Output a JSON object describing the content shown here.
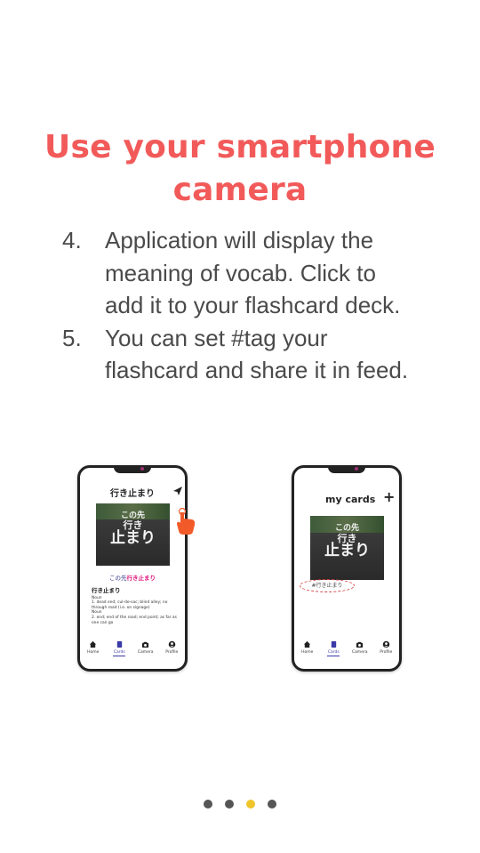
{
  "title": {
    "line1": "Use your smartphone",
    "line2": "camera"
  },
  "steps": [
    {
      "num": "4.",
      "lines": [
        "Application will display the",
        "meaning of vocab. Click to",
        "add it to your flashcard deck."
      ]
    },
    {
      "num": "5.",
      "lines": [
        "You can set #tag your",
        "flashcard and share it in feed."
      ]
    }
  ],
  "phone1": {
    "title": "行き止まり",
    "sign": [
      "この先",
      "行き",
      "止まり"
    ],
    "subtitle_prefix": "この先",
    "subtitle_highlight": "行き止まり",
    "definition": {
      "word": "行き止まり",
      "lines": [
        "Noun",
        "1. dead end; cul-de-sac; blind alley; no through road (i.e. on signage)",
        "Noun",
        "2. end; end of the road; end point; as far as one can go"
      ]
    }
  },
  "phone2": {
    "title": "my cards",
    "add_label": "+",
    "sign": [
      "この先",
      "行き",
      "止まり"
    ],
    "tag": "#行き止まり"
  },
  "nav": [
    "Home",
    "Cards",
    "Camera",
    "Profile"
  ],
  "colors": {
    "accent": "#f25a5a",
    "highlight": "#e0147a",
    "active_dot": "#f0c52b",
    "nav_active": "#3a3aa8"
  },
  "pager": {
    "count": 4,
    "active_index": 2
  }
}
